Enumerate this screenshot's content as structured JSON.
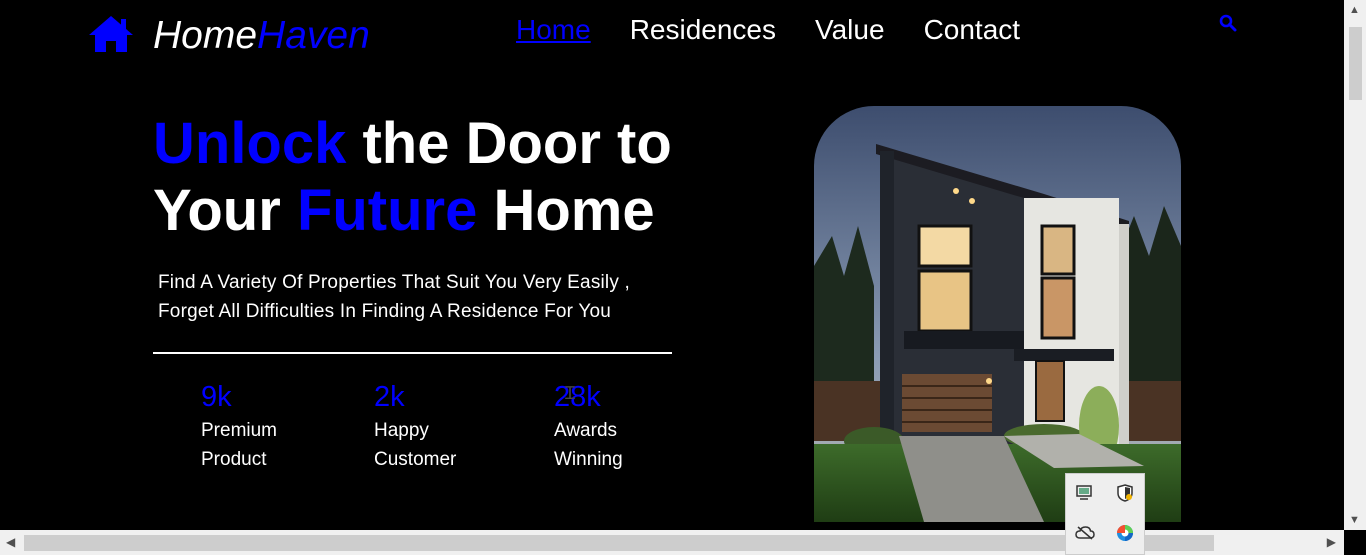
{
  "brand": {
    "part1": "Home",
    "part2": "Haven",
    "icon": "house-icon",
    "accent": "#0000ff"
  },
  "nav": {
    "items": [
      {
        "label": "Home",
        "active": true
      },
      {
        "label": "Residences",
        "active": false
      },
      {
        "label": "Value",
        "active": false
      },
      {
        "label": "Contact",
        "active": false
      }
    ],
    "search_icon": "search-icon"
  },
  "hero": {
    "title_w1": "Unlock",
    "title_w2": " the Door to",
    "title_w3": "Your ",
    "title_w4": "Future",
    "title_w5": " Home",
    "desc_line1": "Find A Variety Of Properties That Suit You Very Easily ,",
    "desc_line2": "Forget All Difficulties In Finding A Residence For You"
  },
  "stats": [
    {
      "value": "9k",
      "label1": "Premium",
      "label2": "Product"
    },
    {
      "value": "2k",
      "label1": "Happy",
      "label2": "Customer"
    },
    {
      "value": "28k",
      "label1": "Awards",
      "label2": "Winning"
    }
  ],
  "image": {
    "subject": "modern two-story house at dusk"
  },
  "tray": {
    "icons": [
      "network-icon",
      "security-shield-icon",
      "cloud-offline-icon",
      "edge-browser-icon"
    ]
  }
}
